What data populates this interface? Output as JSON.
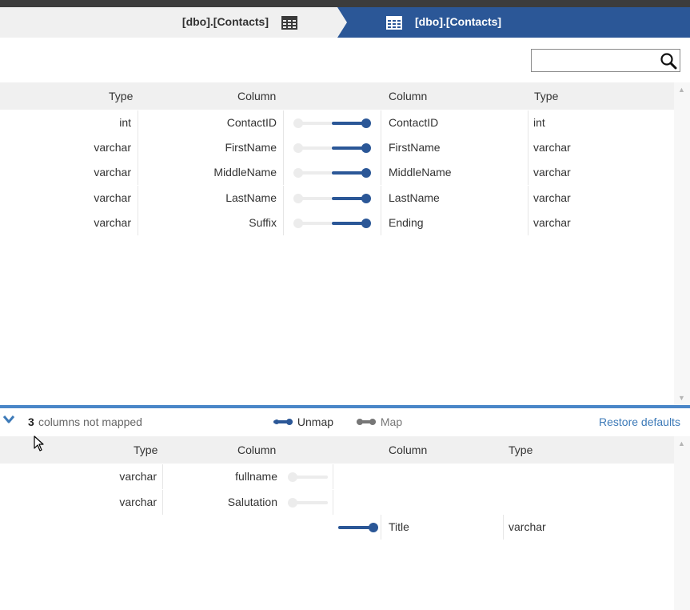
{
  "header": {
    "source_table": "[dbo].[Contacts]",
    "destination_table": "[dbo].[Contacts]"
  },
  "search": {
    "value": "",
    "placeholder": ""
  },
  "mapped": {
    "headers": {
      "source_type": "Type",
      "source_column": "Column",
      "dest_column": "Column",
      "dest_type": "Type"
    },
    "rows": [
      {
        "source_type": "int",
        "source_column": "ContactID",
        "dest_column": "ContactID",
        "dest_type": "int"
      },
      {
        "source_type": "varchar",
        "source_column": "FirstName",
        "dest_column": "FirstName",
        "dest_type": "varchar"
      },
      {
        "source_type": "varchar",
        "source_column": "MiddleName",
        "dest_column": "MiddleName",
        "dest_type": "varchar"
      },
      {
        "source_type": "varchar",
        "source_column": "LastName",
        "dest_column": "LastName",
        "dest_type": "varchar"
      },
      {
        "source_type": "varchar",
        "source_column": "Suffix",
        "dest_column": "Ending",
        "dest_type": "varchar"
      }
    ]
  },
  "unmapped_bar": {
    "count": "3",
    "label": "columns not mapped",
    "unmap_label": "Unmap",
    "map_label": "Map",
    "restore_label": "Restore defaults"
  },
  "unmapped": {
    "headers": {
      "source_type": "Type",
      "source_column": "Column",
      "dest_column": "Column",
      "dest_type": "Type"
    },
    "source_rows": [
      {
        "type": "varchar",
        "column": "fullname"
      },
      {
        "type": "varchar",
        "column": "Salutation"
      }
    ],
    "dest_rows": [
      {
        "column": "Title",
        "type": "varchar"
      }
    ]
  },
  "colors": {
    "accent": "#2b5797",
    "link": "#3d7ab8",
    "divider": "#4a86c8",
    "header_bg": "#f0f0f0",
    "inactive_track": "#ececec",
    "map_legend": "#777777"
  },
  "icons": {
    "table_icon": "table-grid",
    "search_icon": "magnifier",
    "collapse_icon": "chevron-down",
    "unmap_icon": "connector-linked",
    "map_icon": "connector"
  }
}
